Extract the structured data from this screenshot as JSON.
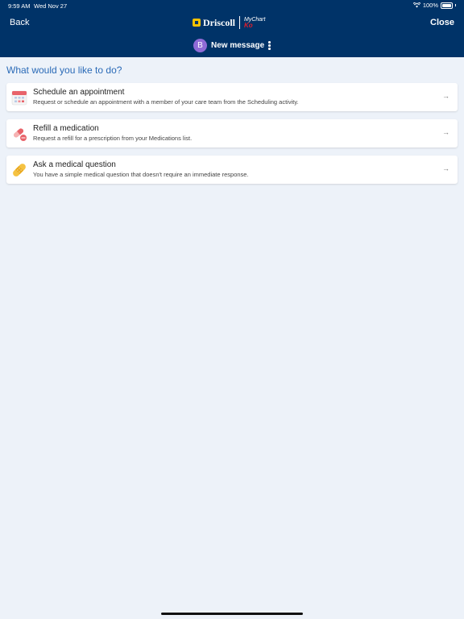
{
  "status_bar": {
    "time": "9:59 AM",
    "date": "Wed Nov 27",
    "battery": "100%"
  },
  "header": {
    "back_label": "Back",
    "close_label": "Close",
    "logo_text": "Driscoll",
    "mychart_logo_text": "MyChart",
    "mychart_logo_sub": "Ko",
    "avatar_initial": "B",
    "new_message_label": "New message"
  },
  "prompt": "What would you like to do?",
  "options": [
    {
      "title": "Schedule an appointment",
      "description": "Request or schedule an appointment with a member of your care team from the Scheduling activity.",
      "icon": "calendar-icon"
    },
    {
      "title": "Refill a medication",
      "description": "Request a refill for a prescription from your Medications list.",
      "icon": "pill-icon"
    },
    {
      "title": "Ask a medical question",
      "description": "You have a simple medical question that doesn't require an immediate response.",
      "icon": "bandage-icon"
    }
  ],
  "arrow_glyph": "→",
  "colors": {
    "header_bg": "#003368",
    "background": "#edf2f9",
    "prompt": "#2a6ab7",
    "avatar": "#8f6bd6"
  }
}
